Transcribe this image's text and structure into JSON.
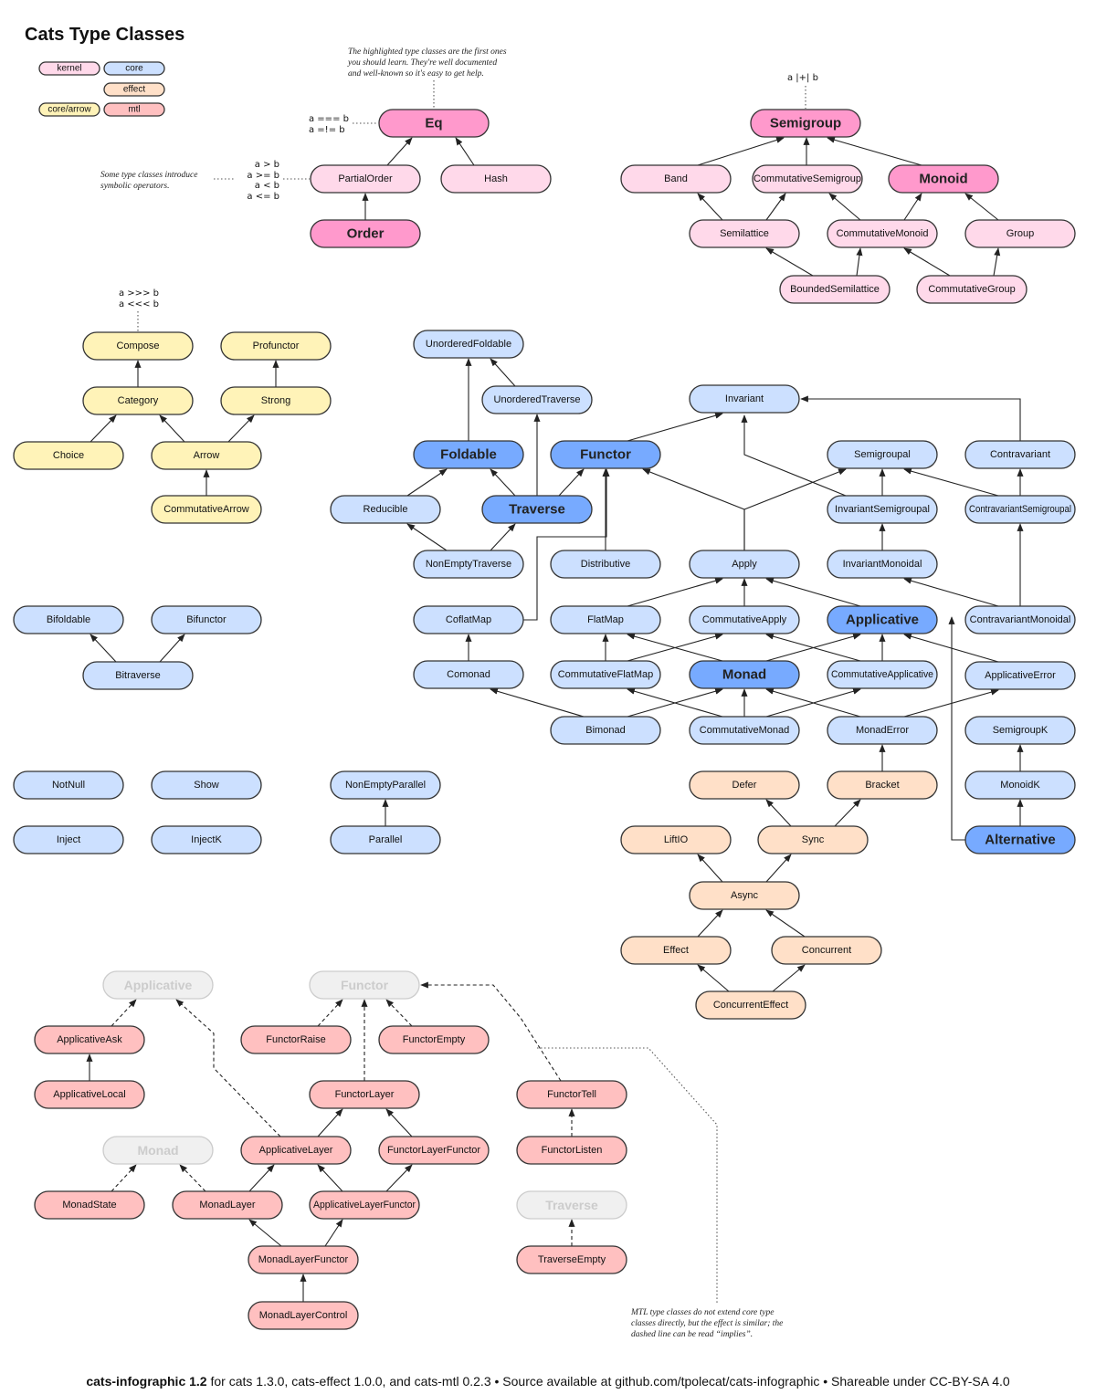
{
  "title": "Cats Type Classes",
  "colors": {
    "kernel": "#ffd9ea",
    "kernel_hl": "#ff99cc",
    "core": "#cce0ff",
    "core_hl": "#77aaff",
    "effect": "#ffe0c8",
    "arrow": "#fff3b8",
    "mtl": "#ffc0c0",
    "ghost": "#f0f0f0"
  },
  "legend": [
    {
      "label": "kernel",
      "category": "kernel"
    },
    {
      "label": "core",
      "category": "core"
    },
    {
      "label": "effect",
      "category": "effect"
    },
    {
      "label": "core/arrow",
      "category": "arrow"
    },
    {
      "label": "mtl",
      "category": "mtl"
    }
  ],
  "notes": {
    "highlighted": "The highlighted type classes are the first ones you should learn. They're well documented and well-known so it's easy to get help.",
    "symbolic": "Some type classes introduce symbolic operators.",
    "mtl": "MTL type classes do not extend core type classes directly, but the effect is similar; the dashed line can be read “implies”."
  },
  "operators": {
    "eq": "a === b\na =!= b",
    "partial_order": "a > b\na >= b\na < b\na <= b",
    "semigroup": "a |+| b",
    "compose": "a >>> b\na <<< b"
  },
  "nodes": [
    {
      "id": "Eq",
      "label": "Eq",
      "category": "kernel",
      "highlighted": true
    },
    {
      "id": "PartialOrder",
      "label": "PartialOrder",
      "category": "kernel"
    },
    {
      "id": "Hash",
      "label": "Hash",
      "category": "kernel"
    },
    {
      "id": "Order",
      "label": "Order",
      "category": "kernel",
      "highlighted": true
    },
    {
      "id": "Semigroup",
      "label": "Semigroup",
      "category": "kernel",
      "highlighted": true
    },
    {
      "id": "Band",
      "label": "Band",
      "category": "kernel"
    },
    {
      "id": "CommutativeSemigroup",
      "label": "CommutativeSemigroup",
      "category": "kernel"
    },
    {
      "id": "Monoid",
      "label": "Monoid",
      "category": "kernel",
      "highlighted": true
    },
    {
      "id": "Semilattice",
      "label": "Semilattice",
      "category": "kernel"
    },
    {
      "id": "CommutativeMonoid",
      "label": "CommutativeMonoid",
      "category": "kernel"
    },
    {
      "id": "Group",
      "label": "Group",
      "category": "kernel"
    },
    {
      "id": "BoundedSemilattice",
      "label": "BoundedSemilattice",
      "category": "kernel"
    },
    {
      "id": "CommutativeGroup",
      "label": "CommutativeGroup",
      "category": "kernel"
    },
    {
      "id": "Compose",
      "label": "Compose",
      "category": "arrow"
    },
    {
      "id": "Profunctor",
      "label": "Profunctor",
      "category": "arrow"
    },
    {
      "id": "Category",
      "label": "Category",
      "category": "arrow"
    },
    {
      "id": "Strong",
      "label": "Strong",
      "category": "arrow"
    },
    {
      "id": "Choice",
      "label": "Choice",
      "category": "arrow"
    },
    {
      "id": "Arrow",
      "label": "Arrow",
      "category": "arrow"
    },
    {
      "id": "CommutativeArrow",
      "label": "CommutativeArrow",
      "category": "arrow"
    },
    {
      "id": "UnorderedFoldable",
      "label": "UnorderedFoldable",
      "category": "core"
    },
    {
      "id": "UnorderedTraverse",
      "label": "UnorderedTraverse",
      "category": "core"
    },
    {
      "id": "Foldable",
      "label": "Foldable",
      "category": "core",
      "highlighted": true
    },
    {
      "id": "Functor",
      "label": "Functor",
      "category": "core",
      "highlighted": true
    },
    {
      "id": "Reducible",
      "label": "Reducible",
      "category": "core"
    },
    {
      "id": "Traverse",
      "label": "Traverse",
      "category": "core",
      "highlighted": true
    },
    {
      "id": "NonEmptyTraverse",
      "label": "NonEmptyTraverse",
      "category": "core"
    },
    {
      "id": "Distributive",
      "label": "Distributive",
      "category": "core"
    },
    {
      "id": "Invariant",
      "label": "Invariant",
      "category": "core"
    },
    {
      "id": "Semigroupal",
      "label": "Semigroupal",
      "category": "core"
    },
    {
      "id": "Contravariant",
      "label": "Contravariant",
      "category": "core"
    },
    {
      "id": "InvariantSemigroupal",
      "label": "InvariantSemigroupal",
      "category": "core"
    },
    {
      "id": "ContravariantSemigroupal",
      "label": "ContravariantSemigroupal",
      "category": "core"
    },
    {
      "id": "Apply",
      "label": "Apply",
      "category": "core"
    },
    {
      "id": "InvariantMonoidal",
      "label": "InvariantMonoidal",
      "category": "core"
    },
    {
      "id": "CoflatMap",
      "label": "CoflatMap",
      "category": "core"
    },
    {
      "id": "FlatMap",
      "label": "FlatMap",
      "category": "core"
    },
    {
      "id": "CommutativeApply",
      "label": "CommutativeApply",
      "category": "core"
    },
    {
      "id": "Applicative",
      "label": "Applicative",
      "category": "core",
      "highlighted": true
    },
    {
      "id": "ContravariantMonoidal",
      "label": "ContravariantMonoidal",
      "category": "core"
    },
    {
      "id": "Comonad",
      "label": "Comonad",
      "category": "core"
    },
    {
      "id": "CommutativeFlatMap",
      "label": "CommutativeFlatMap",
      "category": "core"
    },
    {
      "id": "Monad",
      "label": "Monad",
      "category": "core",
      "highlighted": true
    },
    {
      "id": "CommutativeApplicative",
      "label": "CommutativeApplicative",
      "category": "core"
    },
    {
      "id": "ApplicativeError",
      "label": "ApplicativeError",
      "category": "core"
    },
    {
      "id": "Bimonad",
      "label": "Bimonad",
      "category": "core"
    },
    {
      "id": "CommutativeMonad",
      "label": "CommutativeMonad",
      "category": "core"
    },
    {
      "id": "MonadError",
      "label": "MonadError",
      "category": "core"
    },
    {
      "id": "SemigroupK",
      "label": "SemigroupK",
      "category": "core"
    },
    {
      "id": "MonoidK",
      "label": "MonoidK",
      "category": "core"
    },
    {
      "id": "Alternative",
      "label": "Alternative",
      "category": "core",
      "highlighted": true
    },
    {
      "id": "Bifoldable",
      "label": "Bifoldable",
      "category": "core"
    },
    {
      "id": "Bifunctor",
      "label": "Bifunctor",
      "category": "core"
    },
    {
      "id": "Bitraverse",
      "label": "Bitraverse",
      "category": "core"
    },
    {
      "id": "NotNull",
      "label": "NotNull",
      "category": "core"
    },
    {
      "id": "Show",
      "label": "Show",
      "category": "core"
    },
    {
      "id": "Inject",
      "label": "Inject",
      "category": "core"
    },
    {
      "id": "InjectK",
      "label": "InjectK",
      "category": "core"
    },
    {
      "id": "NonEmptyParallel",
      "label": "NonEmptyParallel",
      "category": "core"
    },
    {
      "id": "Parallel",
      "label": "Parallel",
      "category": "core"
    },
    {
      "id": "Defer",
      "label": "Defer",
      "category": "effect"
    },
    {
      "id": "Bracket",
      "label": "Bracket",
      "category": "effect"
    },
    {
      "id": "LiftIO",
      "label": "LiftIO",
      "category": "effect"
    },
    {
      "id": "Sync",
      "label": "Sync",
      "category": "effect"
    },
    {
      "id": "Async",
      "label": "Async",
      "category": "effect"
    },
    {
      "id": "Effect",
      "label": "Effect",
      "category": "effect"
    },
    {
      "id": "Concurrent",
      "label": "Concurrent",
      "category": "effect"
    },
    {
      "id": "ConcurrentEffect",
      "label": "ConcurrentEffect",
      "category": "effect"
    },
    {
      "id": "GhostApplicative",
      "label": "Applicative",
      "category": "ghost"
    },
    {
      "id": "GhostFunctor",
      "label": "Functor",
      "category": "ghost"
    },
    {
      "id": "GhostMonad",
      "label": "Monad",
      "category": "ghost"
    },
    {
      "id": "GhostTraverse",
      "label": "Traverse",
      "category": "ghost"
    },
    {
      "id": "ApplicativeAsk",
      "label": "ApplicativeAsk",
      "category": "mtl"
    },
    {
      "id": "ApplicativeLocal",
      "label": "ApplicativeLocal",
      "category": "mtl"
    },
    {
      "id": "FunctorRaise",
      "label": "FunctorRaise",
      "category": "mtl"
    },
    {
      "id": "FunctorEmpty",
      "label": "FunctorEmpty",
      "category": "mtl"
    },
    {
      "id": "FunctorLayer",
      "label": "FunctorLayer",
      "category": "mtl"
    },
    {
      "id": "FunctorTell",
      "label": "FunctorTell",
      "category": "mtl"
    },
    {
      "id": "ApplicativeLayer",
      "label": "ApplicativeLayer",
      "category": "mtl"
    },
    {
      "id": "FunctorLayerFunctor",
      "label": "FunctorLayerFunctor",
      "category": "mtl"
    },
    {
      "id": "FunctorListen",
      "label": "FunctorListen",
      "category": "mtl"
    },
    {
      "id": "MonadState",
      "label": "MonadState",
      "category": "mtl"
    },
    {
      "id": "MonadLayer",
      "label": "MonadLayer",
      "category": "mtl"
    },
    {
      "id": "ApplicativeLayerFunctor",
      "label": "ApplicativeLayerFunctor",
      "category": "mtl"
    },
    {
      "id": "TraverseEmpty",
      "label": "TraverseEmpty",
      "category": "mtl"
    },
    {
      "id": "MonadLayerFunctor",
      "label": "MonadLayerFunctor",
      "category": "mtl"
    },
    {
      "id": "MonadLayerControl",
      "label": "MonadLayerControl",
      "category": "mtl"
    }
  ],
  "edges": [
    {
      "from": "PartialOrder",
      "to": "Eq"
    },
    {
      "from": "Hash",
      "to": "Eq"
    },
    {
      "from": "Order",
      "to": "PartialOrder"
    },
    {
      "from": "Band",
      "to": "Semigroup"
    },
    {
      "from": "CommutativeSemigroup",
      "to": "Semigroup"
    },
    {
      "from": "Monoid",
      "to": "Semigroup"
    },
    {
      "from": "Semilattice",
      "to": "Band"
    },
    {
      "from": "Semilattice",
      "to": "CommutativeSemigroup"
    },
    {
      "from": "CommutativeMonoid",
      "to": "CommutativeSemigroup"
    },
    {
      "from": "CommutativeMonoid",
      "to": "Monoid"
    },
    {
      "from": "Group",
      "to": "Monoid"
    },
    {
      "from": "BoundedSemilattice",
      "to": "Semilattice"
    },
    {
      "from": "BoundedSemilattice",
      "to": "CommutativeMonoid"
    },
    {
      "from": "CommutativeGroup",
      "to": "CommutativeMonoid"
    },
    {
      "from": "CommutativeGroup",
      "to": "Group"
    },
    {
      "from": "Category",
      "to": "Compose"
    },
    {
      "from": "Strong",
      "to": "Profunctor"
    },
    {
      "from": "Choice",
      "to": "Category"
    },
    {
      "from": "Arrow",
      "to": "Category"
    },
    {
      "from": "Arrow",
      "to": "Strong"
    },
    {
      "from": "CommutativeArrow",
      "to": "Arrow"
    },
    {
      "from": "Foldable",
      "to": "UnorderedFoldable"
    },
    {
      "from": "UnorderedTraverse",
      "to": "UnorderedFoldable"
    },
    {
      "from": "Traverse",
      "to": "UnorderedTraverse"
    },
    {
      "from": "Traverse",
      "to": "Foldable"
    },
    {
      "from": "Traverse",
      "to": "Functor"
    },
    {
      "from": "Reducible",
      "to": "Foldable"
    },
    {
      "from": "NonEmptyTraverse",
      "to": "Reducible"
    },
    {
      "from": "NonEmptyTraverse",
      "to": "Traverse"
    },
    {
      "from": "Distributive",
      "to": "Functor"
    },
    {
      "from": "CoflatMap",
      "to": "Functor"
    },
    {
      "from": "Comonad",
      "to": "CoflatMap"
    },
    {
      "from": "Functor",
      "to": "Invariant"
    },
    {
      "from": "Contravariant",
      "to": "Invariant"
    },
    {
      "from": "Apply",
      "to": "Functor"
    },
    {
      "from": "Apply",
      "to": "Semigroupal"
    },
    {
      "from": "InvariantSemigroupal",
      "to": "Semigroupal"
    },
    {
      "from": "InvariantSemigroupal",
      "to": "Invariant"
    },
    {
      "from": "ContravariantSemigroupal",
      "to": "Semigroupal"
    },
    {
      "from": "ContravariantSemigroupal",
      "to": "Contravariant"
    },
    {
      "from": "InvariantMonoidal",
      "to": "InvariantSemigroupal"
    },
    {
      "from": "ContravariantMonoidal",
      "to": "ContravariantSemigroupal"
    },
    {
      "from": "ContravariantMonoidal",
      "to": "InvariantMonoidal"
    },
    {
      "from": "FlatMap",
      "to": "Apply"
    },
    {
      "from": "CommutativeApply",
      "to": "Apply"
    },
    {
      "from": "Applicative",
      "to": "Apply"
    },
    {
      "from": "CommutativeFlatMap",
      "to": "FlatMap"
    },
    {
      "from": "CommutativeFlatMap",
      "to": "CommutativeApply"
    },
    {
      "from": "Monad",
      "to": "FlatMap"
    },
    {
      "from": "Monad",
      "to": "Applicative"
    },
    {
      "from": "CommutativeApplicative",
      "to": "CommutativeApply"
    },
    {
      "from": "CommutativeApplicative",
      "to": "Applicative"
    },
    {
      "from": "ApplicativeError",
      "to": "Applicative"
    },
    {
      "from": "Bimonad",
      "to": "Comonad"
    },
    {
      "from": "Bimonad",
      "to": "Monad"
    },
    {
      "from": "CommutativeMonad",
      "to": "CommutativeFlatMap"
    },
    {
      "from": "CommutativeMonad",
      "to": "Monad"
    },
    {
      "from": "CommutativeMonad",
      "to": "CommutativeApplicative"
    },
    {
      "from": "MonadError",
      "to": "Monad"
    },
    {
      "from": "MonadError",
      "to": "ApplicativeError"
    },
    {
      "from": "MonoidK",
      "to": "SemigroupK"
    },
    {
      "from": "Alternative",
      "to": "MonoidK"
    },
    {
      "from": "Alternative",
      "to": "Applicative"
    },
    {
      "from": "Bitraverse",
      "to": "Bifoldable"
    },
    {
      "from": "Bitraverse",
      "to": "Bifunctor"
    },
    {
      "from": "Parallel",
      "to": "NonEmptyParallel"
    },
    {
      "from": "Bracket",
      "to": "MonadError"
    },
    {
      "from": "Sync",
      "to": "Defer"
    },
    {
      "from": "Sync",
      "to": "Bracket"
    },
    {
      "from": "Async",
      "to": "LiftIO"
    },
    {
      "from": "Async",
      "to": "Sync"
    },
    {
      "from": "Effect",
      "to": "Async"
    },
    {
      "from": "Concurrent",
      "to": "Async"
    },
    {
      "from": "ConcurrentEffect",
      "to": "Effect"
    },
    {
      "from": "ConcurrentEffect",
      "to": "Concurrent"
    },
    {
      "from": "ApplicativeAsk",
      "to": "GhostApplicative",
      "style": "dashed"
    },
    {
      "from": "ApplicativeLocal",
      "to": "ApplicativeAsk"
    },
    {
      "from": "FunctorRaise",
      "to": "GhostFunctor",
      "style": "dashed"
    },
    {
      "from": "FunctorEmpty",
      "to": "GhostFunctor",
      "style": "dashed"
    },
    {
      "from": "FunctorLayer",
      "to": "GhostFunctor",
      "style": "dashed"
    },
    {
      "from": "ApplicativeLayer",
      "to": "GhostApplicative",
      "style": "dashed"
    },
    {
      "from": "ApplicativeLayer",
      "to": "FunctorLayer"
    },
    {
      "from": "FunctorLayerFunctor",
      "to": "FunctorLayer"
    },
    {
      "from": "FunctorTell",
      "to": "GhostFunctor",
      "style": "dashed"
    },
    {
      "from": "FunctorListen",
      "to": "FunctorTell",
      "style": "dashed"
    },
    {
      "from": "MonadState",
      "to": "GhostMonad",
      "style": "dashed"
    },
    {
      "from": "MonadLayer",
      "to": "GhostMonad",
      "style": "dashed"
    },
    {
      "from": "MonadLayer",
      "to": "ApplicativeLayer"
    },
    {
      "from": "ApplicativeLayerFunctor",
      "to": "ApplicativeLayer"
    },
    {
      "from": "ApplicativeLayerFunctor",
      "to": "FunctorLayerFunctor"
    },
    {
      "from": "TraverseEmpty",
      "to": "GhostTraverse",
      "style": "dashed"
    },
    {
      "from": "MonadLayerFunctor",
      "to": "MonadLayer"
    },
    {
      "from": "MonadLayerFunctor",
      "to": "ApplicativeLayerFunctor"
    },
    {
      "from": "MonadLayerControl",
      "to": "MonadLayerFunctor"
    }
  ],
  "footer": {
    "name": "cats-infographic 1.2",
    "text": " for cats 1.3.0, cats-effect 1.0.0, and cats-mtl 0.2.3 • Source available at github.com/tpolecat/cats-infographic • Shareable under CC-BY-SA 4.0"
  }
}
